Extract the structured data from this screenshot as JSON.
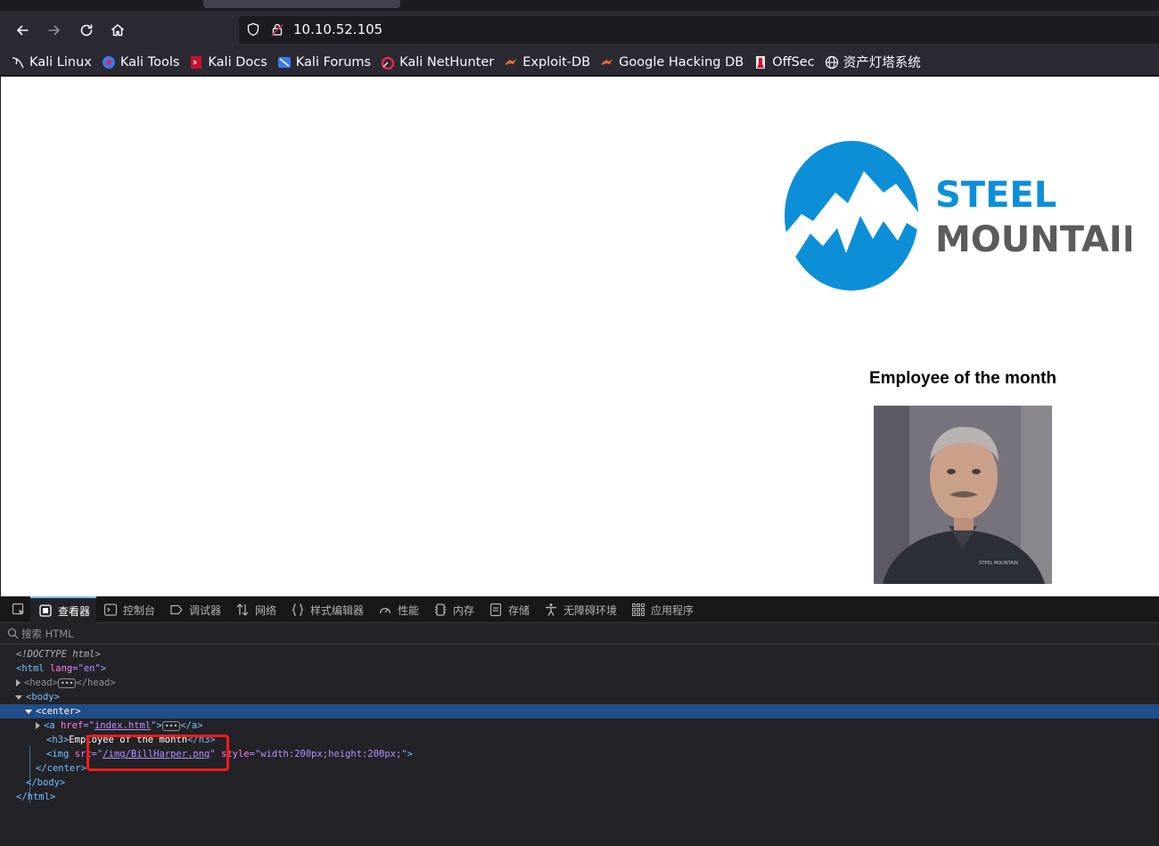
{
  "browser": {
    "url": "10.10.52.105",
    "bookmarks": [
      {
        "label": "Kali Linux",
        "icon": "kali-dragon-icon"
      },
      {
        "label": "Kali Tools",
        "icon": "kali-tools-icon"
      },
      {
        "label": "Kali Docs",
        "icon": "kali-docs-icon"
      },
      {
        "label": "Kali Forums",
        "icon": "kali-forums-icon"
      },
      {
        "label": "Kali NetHunter",
        "icon": "nethunter-icon"
      },
      {
        "label": "Exploit-DB",
        "icon": "exploit-db-icon"
      },
      {
        "label": "Google Hacking DB",
        "icon": "ghdb-icon"
      },
      {
        "label": "OffSec",
        "icon": "offsec-icon"
      },
      {
        "label": "资产灯塔系统",
        "icon": "globe-icon"
      }
    ]
  },
  "page": {
    "logo_line1": "STEEL",
    "logo_line2": "MOUNTAIN",
    "heading": "Employee of the month",
    "logo_color": "#0d8fd8",
    "logo_text_gray": "#5b5b5b"
  },
  "devtools": {
    "tabs": [
      {
        "label": "查看器",
        "icon": "inspector-icon",
        "active": true
      },
      {
        "label": "控制台",
        "icon": "console-icon"
      },
      {
        "label": "调试器",
        "icon": "debugger-icon"
      },
      {
        "label": "网络",
        "icon": "network-icon"
      },
      {
        "label": "样式编辑器",
        "icon": "style-editor-icon"
      },
      {
        "label": "性能",
        "icon": "performance-icon"
      },
      {
        "label": "内存",
        "icon": "memory-icon"
      },
      {
        "label": "存储",
        "icon": "storage-icon"
      },
      {
        "label": "无障碍环境",
        "icon": "accessibility-icon"
      },
      {
        "label": "应用程序",
        "icon": "application-icon"
      }
    ],
    "search_placeholder": "搜索 HTML",
    "tree": {
      "doctype": "<!DOCTYPE html>",
      "html_open": "<html",
      "lang_attr": "lang",
      "lang_val": "\"en\"",
      "head": "<head",
      "head_close": "</head>",
      "body_open": "<body",
      "center_open": "<center",
      "a_open": "<a",
      "href_attr": "href",
      "href_val": "index.html",
      "a_close": "</a>",
      "h3_open": "<h3",
      "h3_text": "Employee of the month",
      "h3_close": "</h3>",
      "img_open": "<img",
      "src_attr": "src",
      "src_val": "/img/BillHarper.png",
      "style_attr": "style",
      "style_val": "\"width:200px;height:200px;\"",
      "center_close": "</center>",
      "body_close": "</body>",
      "html_close": "</html>"
    },
    "selection_color": "#204e8a",
    "highlight_color": "#ff1a1a"
  }
}
